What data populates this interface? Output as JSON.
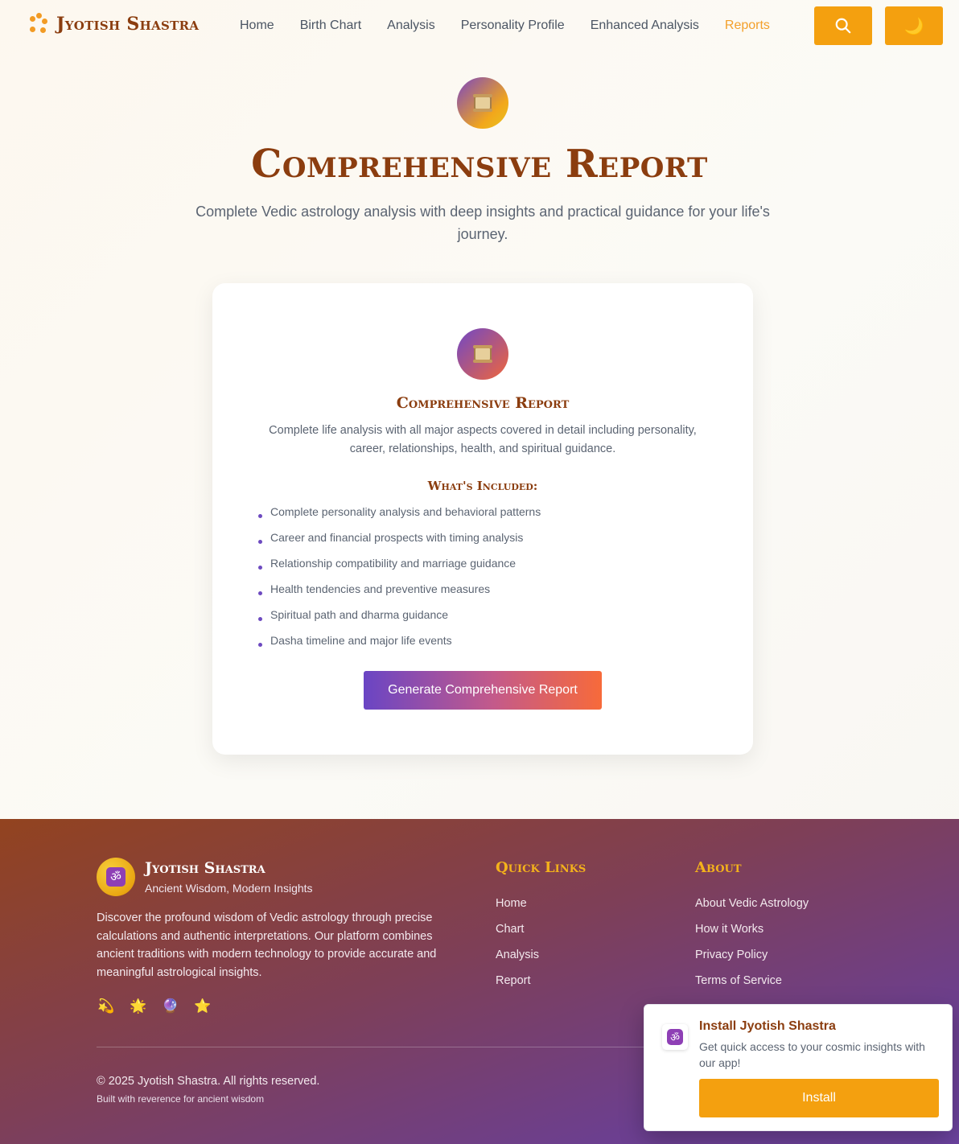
{
  "header": {
    "brand": "Jyotish Shastra",
    "nav": [
      "Home",
      "Birth Chart",
      "Analysis",
      "Personality Profile",
      "Enhanced Analysis",
      "Reports"
    ],
    "active_nav": "Reports",
    "search_icon": "search-icon",
    "theme_icon": "moon-icon",
    "theme_glyph": "🌙"
  },
  "hero": {
    "icon": "scroll-icon",
    "title": "Comprehensive Report",
    "subtitle": "Complete Vedic astrology analysis with deep insights and practical guidance for your life's journey."
  },
  "card": {
    "icon": "scroll-icon",
    "title": "Comprehensive Report",
    "description": "Complete life analysis with all major aspects covered in detail including personality, career, relationships, health, and spiritual guidance.",
    "included_title": "What's Included:",
    "features": [
      "Complete personality analysis and behavioral patterns",
      "Career and financial prospects with timing analysis",
      "Relationship compatibility and marriage guidance",
      "Health tendencies and preventive measures",
      "Spiritual path and dharma guidance",
      "Dasha timeline and major life events"
    ],
    "button": "Generate Comprehensive Report"
  },
  "footer": {
    "om_glyph": "ॐ",
    "brand": "Jyotish Shastra",
    "tagline": "Ancient Wisdom, Modern Insights",
    "description": "Discover the profound wisdom of Vedic astrology through precise calculations and authentic interpretations. Our platform combines ancient traditions with modern technology to provide accurate and meaningful astrological insights.",
    "emojis": [
      "💫",
      "🌟",
      "🔮",
      "⭐"
    ],
    "quick_links_title": "Quick Links",
    "quick_links": [
      "Home",
      "Chart",
      "Analysis",
      "Report"
    ],
    "about_title": "About",
    "about_links": [
      "About Vedic Astrology",
      "How it Works",
      "Privacy Policy",
      "Terms of Service"
    ],
    "copyright": "© 2025 Jyotish Shastra. All rights reserved.",
    "built": "Built with reverence for ancient wisdom"
  },
  "install_popup": {
    "title": "Install Jyotish Shastra",
    "text": "Get quick access to your cosmic insights with our app!",
    "button": "Install"
  },
  "colors": {
    "accent": "#f4a00f",
    "brand_brown": "#8b3d0f",
    "purple": "#6a45c4",
    "orange": "#f76a3a"
  }
}
